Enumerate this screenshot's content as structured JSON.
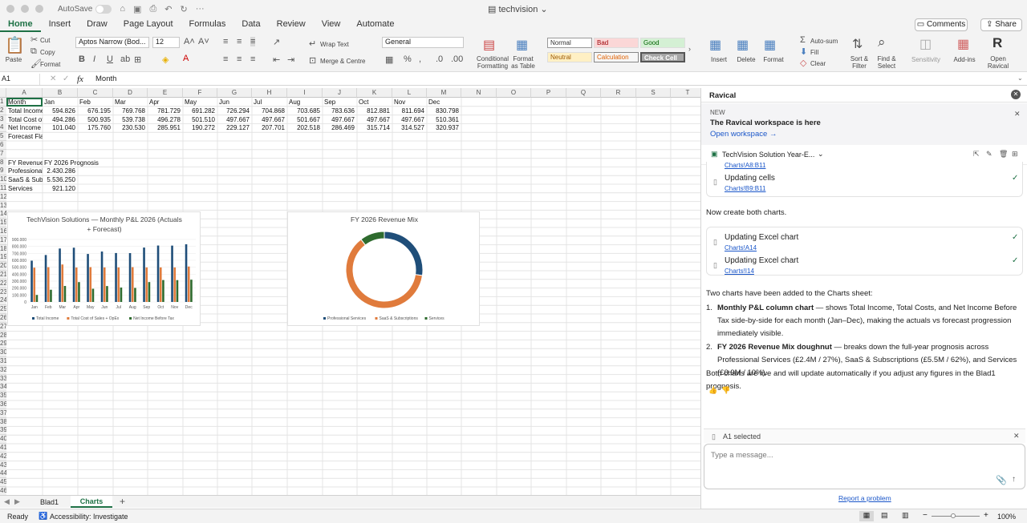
{
  "app": {
    "autosave_label": "AutoSave",
    "doc_title": "techvision"
  },
  "ribbon_tabs": [
    "Home",
    "Insert",
    "Draw",
    "Page Layout",
    "Formulas",
    "Data",
    "Review",
    "View",
    "Automate"
  ],
  "toolbar": {
    "comments": "Comments",
    "share": "Share",
    "paste": "Paste",
    "cut": "Cut",
    "copy": "Copy",
    "format": "Format",
    "font_name": "Aptos Narrow (Bod...",
    "font_size": "12",
    "wrap_text": "Wrap Text",
    "merge_centre": "Merge & Centre",
    "number_format": "General",
    "conditional_formatting": "Conditional\nFormatting",
    "format_as_table": "Format\nas Table",
    "styles": {
      "normal": "Normal",
      "bad": "Bad",
      "good": "Good",
      "neutral": "Neutral",
      "calculation": "Calculation",
      "check_cell": "Check Cell"
    },
    "insert": "Insert",
    "delete": "Delete",
    "format_cells": "Format",
    "autosum": "Auto-sum",
    "fill": "Fill",
    "clear": "Clear",
    "sort_filter": "Sort &\nFilter",
    "find_select": "Find &\nSelect",
    "sensitivity": "Sensitivity",
    "addins": "Add-ins",
    "open_ravical": "Open\nRavical"
  },
  "formula_bar": {
    "name_box": "A1",
    "fx": "fx",
    "value": "Month"
  },
  "columns": [
    "A",
    "B",
    "C",
    "D",
    "E",
    "F",
    "G",
    "H",
    "I",
    "J",
    "K",
    "L",
    "M",
    "N",
    "O",
    "P",
    "Q",
    "R",
    "S",
    "T"
  ],
  "rows": [
    "1",
    "2",
    "3",
    "4",
    "5",
    "6",
    "7",
    "8",
    "9",
    "10",
    "11",
    "12",
    "13",
    "14",
    "15",
    "16",
    "17",
    "18",
    "19",
    "20",
    "21",
    "22",
    "23",
    "24",
    "25",
    "26",
    "27",
    "28",
    "29",
    "30",
    "31",
    "32",
    "33",
    "34",
    "35",
    "36",
    "37",
    "38",
    "39",
    "40",
    "41",
    "42",
    "43",
    "44",
    "45",
    "46"
  ],
  "sheet": {
    "months": [
      "Month",
      "Jan",
      "Feb",
      "Mar",
      "Apr",
      "May",
      "Jun",
      "Jul",
      "Aug",
      "Sep",
      "Oct",
      "Nov",
      "Dec"
    ],
    "row_total_income": [
      "Total Income",
      "594.826",
      "676.195",
      "769.768",
      "781.729",
      "691.282",
      "726.294",
      "704.868",
      "703.685",
      "783.636",
      "812.881",
      "811.694",
      "830.798"
    ],
    "row_total_cost": [
      "Total Cost of",
      "494.286",
      "500.935",
      "539.738",
      "496.278",
      "501.510",
      "497.667",
      "497.667",
      "501.667",
      "497.667",
      "497.667",
      "497.667",
      "510.361"
    ],
    "row_net_income": [
      "Net Income B",
      "101.040",
      "175.760",
      "230.530",
      "285.951",
      "190.272",
      "229.127",
      "207.701",
      "202.518",
      "286.469",
      "315.714",
      "314.527",
      "320.937"
    ],
    "forecast_flag": "Forecast Flag",
    "fy_label": "FY Revenue M",
    "fy_prognosis": "FY 2026 Prognosis",
    "prof_services_label": "Professional",
    "prof_services_value": "2.430.286",
    "saas_label": "SaaS & Subsc",
    "saas_value": "5.536.250",
    "services_label": "Services",
    "services_value": "921.120"
  },
  "chart_data": [
    {
      "type": "bar",
      "title": "TechVision Solutions — Monthly P&L 2026 (Actuals + Forecast)",
      "categories": [
        "Jan",
        "Feb",
        "Mar",
        "Apr",
        "May",
        "Jun",
        "Jul",
        "Aug",
        "Sep",
        "Oct",
        "Nov",
        "Dec"
      ],
      "y_ticks": [
        "900.000",
        "800.000",
        "700.000",
        "600.000",
        "500.000",
        "400.000",
        "300.000",
        "200.000",
        "100.000",
        "0"
      ],
      "ylim": [
        0,
        900000
      ],
      "series": [
        {
          "name": "Total Income",
          "color": "#1f4e79",
          "values": [
            594826,
            676195,
            769768,
            781729,
            691282,
            726294,
            704868,
            703685,
            783636,
            812881,
            811694,
            830798
          ]
        },
        {
          "name": "Total Cost of Sales + OpEx",
          "color": "#e07b3c",
          "values": [
            494286,
            500935,
            539738,
            496278,
            501510,
            497667,
            497667,
            501667,
            497667,
            497667,
            497667,
            510361
          ]
        },
        {
          "name": "Net Income Before Tax",
          "color": "#2e6b2e",
          "values": [
            101040,
            175760,
            230530,
            285951,
            190272,
            229127,
            207701,
            202518,
            286469,
            315714,
            314527,
            320937
          ]
        }
      ],
      "legend": "bottom"
    },
    {
      "type": "pie",
      "title": "FY 2026 Revenue Mix",
      "categories": [
        "Professional Services",
        "SaaS & Subscriptions",
        "Services"
      ],
      "values": [
        2430286,
        5536250,
        921120
      ],
      "colors": [
        "#1f4e79",
        "#e07b3c",
        "#2e6b2e"
      ],
      "legend": "bottom"
    }
  ],
  "sheet_tabs": [
    "Blad1",
    "Charts"
  ],
  "status": {
    "ready": "Ready",
    "accessibility": "Accessibility: Investigate",
    "zoom": "100%"
  },
  "panel": {
    "title": "Ravical",
    "new_badge": "NEW",
    "announcement": "The Ravical workspace is here",
    "open_workspace": "Open workspace",
    "doc_name": "TechVision Solution Year-E...",
    "prev_ref": "Charts!A8:B11",
    "step1_label": "Updating cells",
    "step1_ref": "Charts!B9:B11",
    "prompt": "Now create both charts.",
    "step2_label": "Updating Excel chart",
    "step2_ref": "Charts!A14",
    "step3_label": "Updating Excel chart",
    "step3_ref": "Charts!I14",
    "summary": "Two charts have been added to the Charts sheet:",
    "item1_bold": "Monthly P&L column chart",
    "item1_text": " — shows Total Income, Total Costs, and Net Income Before Tax side-by-side for each month (Jan–Dec), making the actuals vs forecast progression immediately visible.",
    "item2_bold": "FY 2026 Revenue Mix doughnut",
    "item2_text": " — breaks down the full-year prognosis across Professional Services (£2.4M / 27%), SaaS & Subscriptions (£5.5M / 62%), and Services (£0.9M / 10%).",
    "closing": "Both charts are live and will update automatically if you adjust any figures in the Blad1 prognosis.",
    "selection": "A1 selected",
    "message_placeholder": "Type a message...",
    "report": "Report a problem"
  }
}
